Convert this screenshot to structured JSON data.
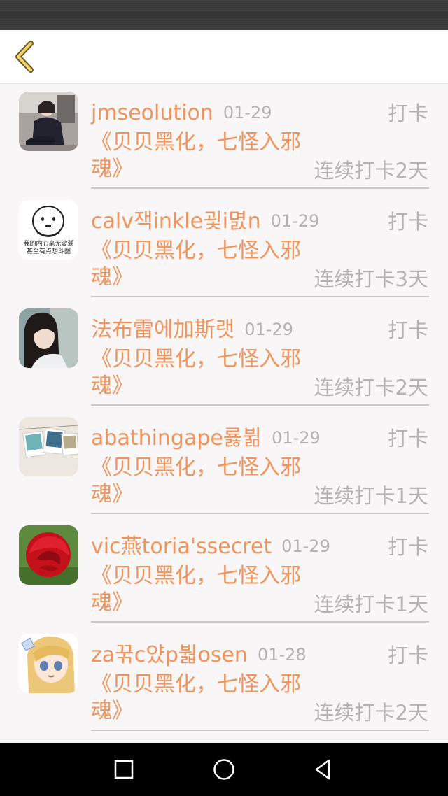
{
  "header": {
    "back_icon": "chevron-left-icon"
  },
  "items": [
    {
      "name": "jmseolution",
      "date": "01-29",
      "action": "打卡",
      "book": "《贝贝黑化，七怪入邪魂》",
      "streak": "连续打卡2天",
      "avatar": "photo-girl-sitting"
    },
    {
      "name": "calv잭inkle굋i멼n",
      "date": "01-29",
      "action": "打卡",
      "book": "《贝贝黑化，七怪入邪魂》",
      "streak": "连续打卡3天",
      "avatar": "cartoon-face-meme"
    },
    {
      "name": "法布雷에加斯랫",
      "date": "01-29",
      "action": "打卡",
      "book": "《贝贝黑化，七怪入邪魂》",
      "streak": "连续打卡2天",
      "avatar": "photo-girl-portrait"
    },
    {
      "name": "abathingape룛뷞",
      "date": "01-29",
      "action": "打卡",
      "book": "《贝贝黑化，七怪入邪魂》",
      "streak": "连续打卡1天",
      "avatar": "polaroid-photos"
    },
    {
      "name": "vic燕toria'ssecret",
      "date": "01-29",
      "action": "打卡",
      "book": "《贝贝黑化，七怪入邪魂》",
      "streak": "连续打卡1天",
      "avatar": "red-rose"
    },
    {
      "name": "za꾺c얐p붧osen",
      "date": "01-28",
      "action": "打卡",
      "book": "《贝贝黑化，七怪入邪魂》",
      "streak": "连续打卡2天",
      "avatar": "anime-girl"
    }
  ],
  "avatar_meme_text": "我的内心毫无波澜 甚至有点想斗图",
  "nav": {
    "recent": "square-icon",
    "home": "circle-icon",
    "back": "triangle-back-icon"
  },
  "colors": {
    "accent": "#f0945c",
    "muted": "#b4b2b3",
    "background": "#f8f6f7"
  }
}
